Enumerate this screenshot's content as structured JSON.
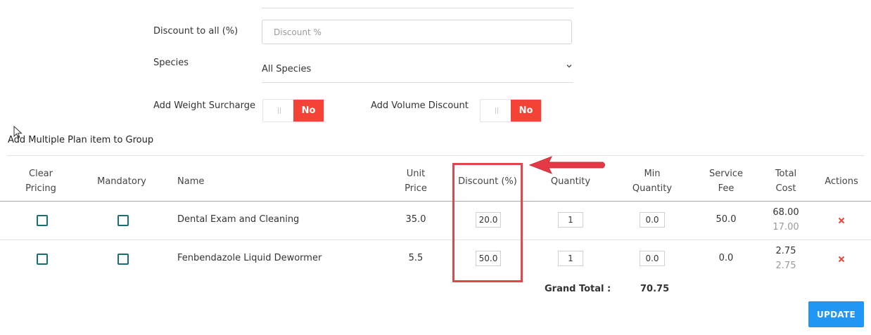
{
  "form": {
    "discount_label": "Discount to all (%)",
    "discount_placeholder": "Discount %",
    "species_label": "Species",
    "species_value": "All Species",
    "weight_surcharge_label": "Add Weight Surcharge",
    "weight_surcharge_state": "No",
    "volume_discount_label": "Add Volume Discount",
    "volume_discount_state": "No"
  },
  "section": {
    "title": "Add Multiple Plan item to Group"
  },
  "table": {
    "headers": {
      "clear_pricing_1": "Clear",
      "clear_pricing_2": "Pricing",
      "mandatory": "Mandatory",
      "name": "Name",
      "unit_price_1": "Unit",
      "unit_price_2": "Price",
      "discount": "Discount (%)",
      "quantity": "Quantity",
      "min_qty_1": "Min",
      "min_qty_2": "Quantity",
      "service_fee_1": "Service",
      "service_fee_2": "Fee",
      "total_cost_1": "Total",
      "total_cost_2": "Cost",
      "actions": "Actions"
    },
    "rows": [
      {
        "name": "Dental Exam and Cleaning",
        "unit_price": "35.0",
        "discount": "20.0",
        "quantity": "1",
        "min_quantity": "0.0",
        "service_fee": "50.0",
        "total_cost": "68.00",
        "total_cost_sub": "17.00"
      },
      {
        "name": "Fenbendazole Liquid Dewormer",
        "unit_price": "5.5",
        "discount": "50.0",
        "quantity": "1",
        "min_quantity": "0.0",
        "service_fee": "0.0",
        "total_cost": "2.75",
        "total_cost_sub": "2.75"
      }
    ],
    "delete_icon": "close-icon"
  },
  "totals": {
    "grand_total_label": "Grand Total :",
    "grand_total_value": "70.75"
  },
  "actions": {
    "update_label": "UPDATE"
  },
  "colors": {
    "accent_red": "#f44336",
    "primary_blue": "#2196f3",
    "checkbox_teal": "#1c6e6e",
    "annotation_red": "#e0474c"
  }
}
